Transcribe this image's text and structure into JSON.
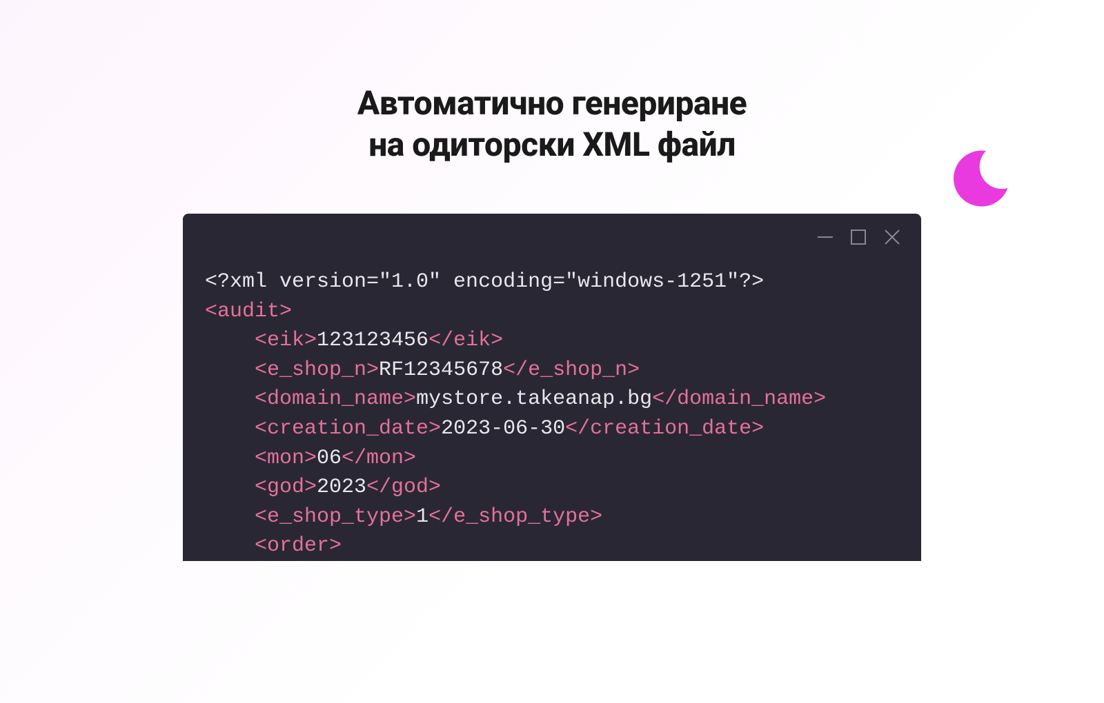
{
  "heading_line1": "Автоматично генериране",
  "heading_line2": "на одиторски XML файл",
  "xml": {
    "declaration": "<?xml version=\"1.0\" encoding=\"windows-1251\"?>",
    "root_open": "<audit>",
    "eik_open": "<eik>",
    "eik_value": "123123456",
    "eik_close": "</eik>",
    "eshopn_open": "<e_shop_n>",
    "eshopn_value": "RF12345678",
    "eshopn_close": "</e_shop_n>",
    "domain_open": "<domain_name>",
    "domain_value": "mystore.takeanap.bg",
    "domain_close": "</domain_name>",
    "cdate_open": "<creation_date>",
    "cdate_value": "2023-06-30",
    "cdate_close": "</creation_date>",
    "mon_open": "<mon>",
    "mon_value": "06",
    "mon_close": "</mon>",
    "god_open": "<god>",
    "god_value": "2023",
    "god_close": "</god>",
    "eshoptype_open": "<e_shop_type>",
    "eshoptype_value": "1",
    "eshoptype_close": "</e_shop_type>",
    "order_open": "<order>"
  }
}
